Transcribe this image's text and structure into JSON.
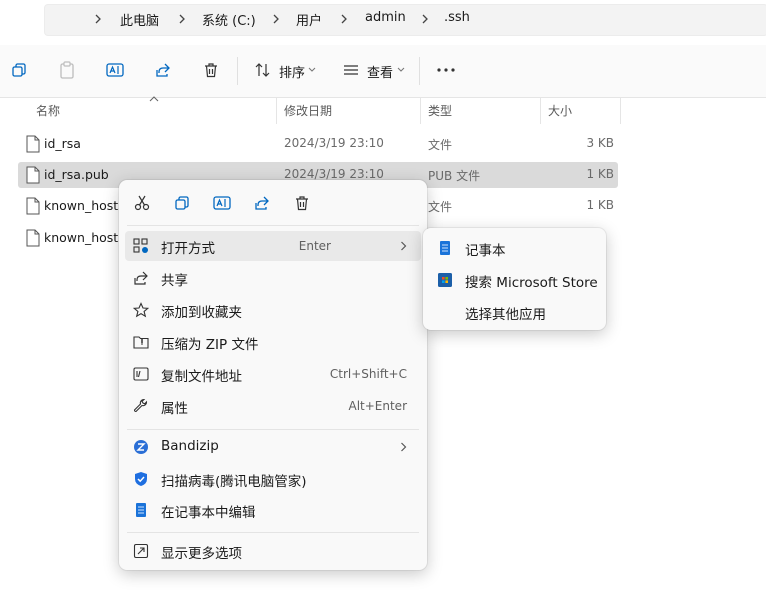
{
  "address": {
    "crumbs": [
      "此电脑",
      "系统 (C:)",
      "用户",
      "admin",
      ".ssh"
    ]
  },
  "toolbar": {
    "sort_label": "排序",
    "view_label": "查看"
  },
  "columns": {
    "name": "名称",
    "modified": "修改日期",
    "type": "类型",
    "size": "大小"
  },
  "files": [
    {
      "name": "id_rsa",
      "modified": "2024/3/19 23:10",
      "type": "文件",
      "size": "3 KB",
      "selected": false
    },
    {
      "name": "id_rsa.pub",
      "modified": "2024/3/19 23:10",
      "type": "PUB 文件",
      "size": "1 KB",
      "selected": true
    },
    {
      "name": "known_hosts",
      "modified": "",
      "type": "文件",
      "size": "1 KB",
      "selected": false
    },
    {
      "name": "known_hosts",
      "modified": "",
      "type": "",
      "size": "",
      "selected": false
    }
  ],
  "context_menu": {
    "quick_actions": [
      "cut-icon",
      "copy-icon",
      "rename-icon",
      "share-icon",
      "delete-icon"
    ],
    "open_with": {
      "label": "打开方式",
      "shortcut": "Enter"
    },
    "share": {
      "label": "共享"
    },
    "favorite": {
      "label": "添加到收藏夹"
    },
    "zip": {
      "label": "压缩为 ZIP 文件"
    },
    "copy_path": {
      "label": "复制文件地址",
      "shortcut": "Ctrl+Shift+C"
    },
    "properties": {
      "label": "属性",
      "shortcut": "Alt+Enter"
    },
    "bandizip": {
      "label": "Bandizip"
    },
    "virus_scan": {
      "label": "扫描病毒(腾讯电脑管家)"
    },
    "edit_notepad": {
      "label": "在记事本中编辑"
    },
    "more_options": {
      "label": "显示更多选项"
    }
  },
  "submenu": {
    "notepad": "记事本",
    "store": "搜索 Microsoft Store",
    "other": "选择其他应用"
  },
  "colors": {
    "accent": "#0067c0",
    "selected_row": "#dadada",
    "menu_bg": "#f9f9f9"
  }
}
